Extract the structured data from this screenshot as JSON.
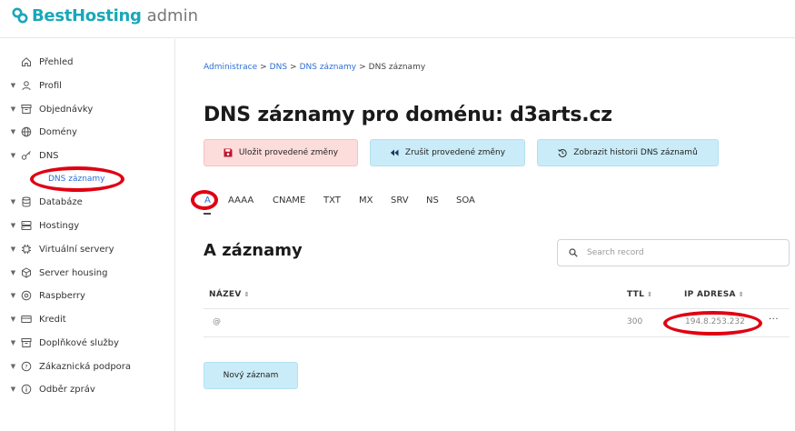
{
  "brand": {
    "name": "BestHosting",
    "suffix": "admin",
    "color": "#1aa7ba"
  },
  "sidebar": {
    "items": [
      {
        "label": "Přehled",
        "icon": "home-icon",
        "caret": false
      },
      {
        "label": "Profil",
        "icon": "user-icon",
        "caret": true
      },
      {
        "label": "Objednávky",
        "icon": "archive-icon",
        "caret": true
      },
      {
        "label": "Domény",
        "icon": "globe-icon",
        "caret": true
      },
      {
        "label": "DNS",
        "icon": "key-icon",
        "caret": true
      },
      {
        "label": "Databáze",
        "icon": "database-icon",
        "caret": true
      },
      {
        "label": "Hostingy",
        "icon": "server-icon",
        "caret": true
      },
      {
        "label": "Virtuální servery",
        "icon": "chip-icon",
        "caret": true
      },
      {
        "label": "Server housing",
        "icon": "cube-icon",
        "caret": true
      },
      {
        "label": "Raspberry",
        "icon": "target-icon",
        "caret": true
      },
      {
        "label": "Kredit",
        "icon": "credit-card-icon",
        "caret": true
      },
      {
        "label": "Doplňkové služby",
        "icon": "archive-icon",
        "caret": true
      },
      {
        "label": "Zákaznická podpora",
        "icon": "help-icon",
        "caret": true
      },
      {
        "label": "Odběr zpráv",
        "icon": "info-icon",
        "caret": true
      }
    ],
    "sub_item": {
      "label": "DNS záznamy",
      "color": "#2c6fd6"
    }
  },
  "breadcrumb": {
    "items": [
      "Administrace",
      "DNS",
      "DNS záznamy"
    ],
    "current": "DNS záznamy",
    "separator": ">"
  },
  "page": {
    "title": "DNS záznamy pro doménu: d3arts.cz"
  },
  "actions": {
    "save": "Uložit provedené změny",
    "cancel": "Zrušit provedené změny",
    "history": "Zobrazit historii DNS záznamů"
  },
  "tabs": [
    "A",
    "AAAA",
    "CNAME",
    "TXT",
    "MX",
    "SRV",
    "NS",
    "SOA"
  ],
  "active_tab": "A",
  "section": {
    "title": "A záznamy"
  },
  "search": {
    "placeholder": "Search record",
    "value": ""
  },
  "table": {
    "columns": [
      "NÁZEV",
      "TTL",
      "IP ADRESA"
    ],
    "rows": [
      {
        "name": "@",
        "ttl": "300",
        "ip": "194.8.253.232"
      }
    ],
    "row_menu": "···"
  },
  "new_button": "Nový záznam",
  "colors": {
    "accent": "#2c6fd6",
    "annotation": "#e00012",
    "save_bg": "#fddcdc",
    "action_bg": "#c9ecf8"
  }
}
